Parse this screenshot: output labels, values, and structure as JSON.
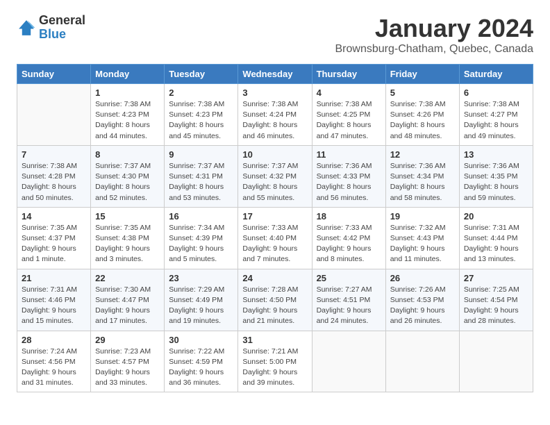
{
  "header": {
    "logo_general": "General",
    "logo_blue": "Blue",
    "month_title": "January 2024",
    "location": "Brownsburg-Chatham, Quebec, Canada"
  },
  "weekdays": [
    "Sunday",
    "Monday",
    "Tuesday",
    "Wednesday",
    "Thursday",
    "Friday",
    "Saturday"
  ],
  "weeks": [
    [
      {
        "day": "",
        "sunrise": "",
        "sunset": "",
        "daylight": ""
      },
      {
        "day": "1",
        "sunrise": "Sunrise: 7:38 AM",
        "sunset": "Sunset: 4:23 PM",
        "daylight": "Daylight: 8 hours and 44 minutes."
      },
      {
        "day": "2",
        "sunrise": "Sunrise: 7:38 AM",
        "sunset": "Sunset: 4:23 PM",
        "daylight": "Daylight: 8 hours and 45 minutes."
      },
      {
        "day": "3",
        "sunrise": "Sunrise: 7:38 AM",
        "sunset": "Sunset: 4:24 PM",
        "daylight": "Daylight: 8 hours and 46 minutes."
      },
      {
        "day": "4",
        "sunrise": "Sunrise: 7:38 AM",
        "sunset": "Sunset: 4:25 PM",
        "daylight": "Daylight: 8 hours and 47 minutes."
      },
      {
        "day": "5",
        "sunrise": "Sunrise: 7:38 AM",
        "sunset": "Sunset: 4:26 PM",
        "daylight": "Daylight: 8 hours and 48 minutes."
      },
      {
        "day": "6",
        "sunrise": "Sunrise: 7:38 AM",
        "sunset": "Sunset: 4:27 PM",
        "daylight": "Daylight: 8 hours and 49 minutes."
      }
    ],
    [
      {
        "day": "7",
        "sunrise": "Sunrise: 7:38 AM",
        "sunset": "Sunset: 4:28 PM",
        "daylight": "Daylight: 8 hours and 50 minutes."
      },
      {
        "day": "8",
        "sunrise": "Sunrise: 7:37 AM",
        "sunset": "Sunset: 4:30 PM",
        "daylight": "Daylight: 8 hours and 52 minutes."
      },
      {
        "day": "9",
        "sunrise": "Sunrise: 7:37 AM",
        "sunset": "Sunset: 4:31 PM",
        "daylight": "Daylight: 8 hours and 53 minutes."
      },
      {
        "day": "10",
        "sunrise": "Sunrise: 7:37 AM",
        "sunset": "Sunset: 4:32 PM",
        "daylight": "Daylight: 8 hours and 55 minutes."
      },
      {
        "day": "11",
        "sunrise": "Sunrise: 7:36 AM",
        "sunset": "Sunset: 4:33 PM",
        "daylight": "Daylight: 8 hours and 56 minutes."
      },
      {
        "day": "12",
        "sunrise": "Sunrise: 7:36 AM",
        "sunset": "Sunset: 4:34 PM",
        "daylight": "Daylight: 8 hours and 58 minutes."
      },
      {
        "day": "13",
        "sunrise": "Sunrise: 7:36 AM",
        "sunset": "Sunset: 4:35 PM",
        "daylight": "Daylight: 8 hours and 59 minutes."
      }
    ],
    [
      {
        "day": "14",
        "sunrise": "Sunrise: 7:35 AM",
        "sunset": "Sunset: 4:37 PM",
        "daylight": "Daylight: 9 hours and 1 minute."
      },
      {
        "day": "15",
        "sunrise": "Sunrise: 7:35 AM",
        "sunset": "Sunset: 4:38 PM",
        "daylight": "Daylight: 9 hours and 3 minutes."
      },
      {
        "day": "16",
        "sunrise": "Sunrise: 7:34 AM",
        "sunset": "Sunset: 4:39 PM",
        "daylight": "Daylight: 9 hours and 5 minutes."
      },
      {
        "day": "17",
        "sunrise": "Sunrise: 7:33 AM",
        "sunset": "Sunset: 4:40 PM",
        "daylight": "Daylight: 9 hours and 7 minutes."
      },
      {
        "day": "18",
        "sunrise": "Sunrise: 7:33 AM",
        "sunset": "Sunset: 4:42 PM",
        "daylight": "Daylight: 9 hours and 8 minutes."
      },
      {
        "day": "19",
        "sunrise": "Sunrise: 7:32 AM",
        "sunset": "Sunset: 4:43 PM",
        "daylight": "Daylight: 9 hours and 11 minutes."
      },
      {
        "day": "20",
        "sunrise": "Sunrise: 7:31 AM",
        "sunset": "Sunset: 4:44 PM",
        "daylight": "Daylight: 9 hours and 13 minutes."
      }
    ],
    [
      {
        "day": "21",
        "sunrise": "Sunrise: 7:31 AM",
        "sunset": "Sunset: 4:46 PM",
        "daylight": "Daylight: 9 hours and 15 minutes."
      },
      {
        "day": "22",
        "sunrise": "Sunrise: 7:30 AM",
        "sunset": "Sunset: 4:47 PM",
        "daylight": "Daylight: 9 hours and 17 minutes."
      },
      {
        "day": "23",
        "sunrise": "Sunrise: 7:29 AM",
        "sunset": "Sunset: 4:49 PM",
        "daylight": "Daylight: 9 hours and 19 minutes."
      },
      {
        "day": "24",
        "sunrise": "Sunrise: 7:28 AM",
        "sunset": "Sunset: 4:50 PM",
        "daylight": "Daylight: 9 hours and 21 minutes."
      },
      {
        "day": "25",
        "sunrise": "Sunrise: 7:27 AM",
        "sunset": "Sunset: 4:51 PM",
        "daylight": "Daylight: 9 hours and 24 minutes."
      },
      {
        "day": "26",
        "sunrise": "Sunrise: 7:26 AM",
        "sunset": "Sunset: 4:53 PM",
        "daylight": "Daylight: 9 hours and 26 minutes."
      },
      {
        "day": "27",
        "sunrise": "Sunrise: 7:25 AM",
        "sunset": "Sunset: 4:54 PM",
        "daylight": "Daylight: 9 hours and 28 minutes."
      }
    ],
    [
      {
        "day": "28",
        "sunrise": "Sunrise: 7:24 AM",
        "sunset": "Sunset: 4:56 PM",
        "daylight": "Daylight: 9 hours and 31 minutes."
      },
      {
        "day": "29",
        "sunrise": "Sunrise: 7:23 AM",
        "sunset": "Sunset: 4:57 PM",
        "daylight": "Daylight: 9 hours and 33 minutes."
      },
      {
        "day": "30",
        "sunrise": "Sunrise: 7:22 AM",
        "sunset": "Sunset: 4:59 PM",
        "daylight": "Daylight: 9 hours and 36 minutes."
      },
      {
        "day": "31",
        "sunrise": "Sunrise: 7:21 AM",
        "sunset": "Sunset: 5:00 PM",
        "daylight": "Daylight: 9 hours and 39 minutes."
      },
      {
        "day": "",
        "sunrise": "",
        "sunset": "",
        "daylight": ""
      },
      {
        "day": "",
        "sunrise": "",
        "sunset": "",
        "daylight": ""
      },
      {
        "day": "",
        "sunrise": "",
        "sunset": "",
        "daylight": ""
      }
    ]
  ]
}
